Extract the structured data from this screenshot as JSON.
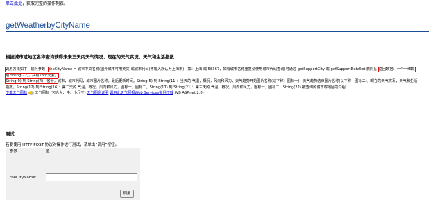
{
  "top": {
    "link_text": "单击此处",
    "text": "，获取完整的操作列表。"
  },
  "operation": {
    "title": "getWeatherbyCityName"
  },
  "description": {
    "title": "根据城市或地区名称查询获得未来三天内天气情况、现在的天气实况、天气和生活指数",
    "seg1": "调用方法如下：输入参数：",
    "seg2": "theCityName = 城市中文名称(国外城市可用英文)或城市代码(不输入默认为上海市)，如：上海 或 58367，",
    "seg3": "如有城市名称重复请使用城市代码查询(可通过 getSupportCity 或 getSupportDataSet 获得)；",
    "seg4": "返回数据：一个一维数",
    "seg5": "组 String(22)，共有23个元素。",
    "line3a": "String(0) 到 String(4)：省份，",
    "line3b": "城市，城市代码，城市图片名称，最后更新时间。String(5) 到 String(11)：当天的 气温，概况，风向和风力，天气趋势开始图片名称(以下称：图标一)，天气趋势结束图片名称(以下称：图标二)，现在的天气实况，天气和生活",
    "line4": "指数。String(12) 到 String(16)：第二天的 气温，概况，风向和风力，图标一，图标二。String(17) 到 String(21)：第三天的 气温，概况，风向和风力，图标一，图标二。String(22) 被查询的城市或地区的介绍",
    "link_icons": "下载天气图标",
    "icons_caption": "天气图标",
    "icon_sizes": "(包含大、中、小尺寸)",
    "link_instructions": "天气图例说明",
    "link_demo": "调用此天气预报Web Services实例下载",
    "vb_note": "(VB ASP.net 2.0)"
  },
  "test": {
    "title": "测试",
    "instruction": "若要使用 HTTP POST 协议对操作进行测试，请单击“调用”按钮。",
    "col_param": "参数",
    "col_value": "值",
    "param_label": "theCityName:",
    "input_value": "",
    "button_label": "调用"
  },
  "colors": {
    "heading": "#1a4d94",
    "link": "#0000cc",
    "highlight_border": "#e01010",
    "table_bg": "#f0f0f0"
  }
}
